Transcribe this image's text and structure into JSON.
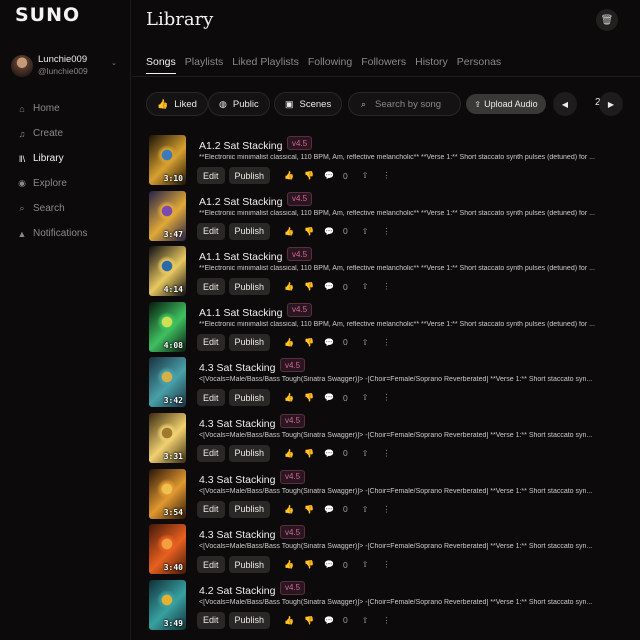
{
  "app": {
    "logo": "SUNO"
  },
  "profile": {
    "name": "Lunchie009",
    "handle": "@lunchie009"
  },
  "nav": [
    {
      "label": "Home",
      "icon": "home-icon",
      "glyph": "⌂",
      "active": false
    },
    {
      "label": "Create",
      "icon": "music-note-icon",
      "glyph": "♫",
      "active": false
    },
    {
      "label": "Library",
      "icon": "library-icon",
      "glyph": "‖\\",
      "active": true
    },
    {
      "label": "Explore",
      "icon": "compass-icon",
      "glyph": "◉",
      "active": false
    },
    {
      "label": "Search",
      "icon": "search-icon",
      "glyph": "⌕",
      "active": false
    },
    {
      "label": "Notifications",
      "icon": "bell-icon",
      "glyph": "▲",
      "active": false
    }
  ],
  "page": {
    "title": "Library"
  },
  "tabs": [
    "Songs",
    "Playlists",
    "Liked Playlists",
    "Following",
    "Followers",
    "History",
    "Personas"
  ],
  "filters": {
    "liked": "Liked",
    "public": "Public",
    "scenes": "Scenes",
    "search_placeholder": "Search by song",
    "upload": "Upload Audio",
    "page": "2"
  },
  "row_actions": {
    "edit": "Edit",
    "publish": "Publish",
    "comments": "0"
  },
  "songs": [
    {
      "title": "A1.2 Sat Stacking",
      "version": "v4.5",
      "duration": "3:10",
      "description": "**Electronic minimalist classical, 110 BPM, Am, reflective melancholic** **Verse 1:** Short staccato synth pulses (detuned) for ...",
      "colors": [
        "#1a1208",
        "#d8a030",
        "#3a7ab8"
      ]
    },
    {
      "title": "A1.2 Sat Stacking",
      "version": "v4.5",
      "duration": "3:47",
      "description": "**Electronic minimalist classical, 110 BPM, Am, reflective melancholic** **Verse 1:** Short staccato synth pulses (detuned) for ...",
      "colors": [
        "#24204a",
        "#e0a838",
        "#7a4ab0"
      ]
    },
    {
      "title": "A1.1 Sat Stacking",
      "version": "v4.5",
      "duration": "4:14",
      "description": "**Electronic minimalist classical, 110 BPM, Am, reflective melancholic** **Verse 1:** Short staccato synth pulses (detuned) for ...",
      "colors": [
        "#0c0c14",
        "#e8c860",
        "#2a6aa8"
      ]
    },
    {
      "title": "A1.1 Sat Stacking",
      "version": "v4.5",
      "duration": "4:08",
      "description": "**Electronic minimalist classical, 110 BPM, Am, reflective melancholic** **Verse 1:** Short staccato synth pulses (detuned) for ...",
      "colors": [
        "#071a0e",
        "#40c060",
        "#d0e050"
      ]
    },
    {
      "title": "4.3 Sat Stacking",
      "version": "v4.5",
      "duration": "3:42",
      "description": "<[Vocals=Male/Bass/Bass Tough(Sinatra Swagger)]> -[Choir=Female/Soprano Reverberated] **Verse 1:** Short staccato syn...",
      "colors": [
        "#1a3040",
        "#48a0a8",
        "#d8b048"
      ]
    },
    {
      "title": "4.3 Sat Stacking",
      "version": "v4.5",
      "duration": "3:31",
      "description": "<[Vocals=Male/Bass/Bass Tough(Sinatra Swagger)]> -[Choir=Female/Soprano Reverberated] **Verse 1:** Short staccato syn...",
      "colors": [
        "#3a2a10",
        "#f0d070",
        "#a07830"
      ]
    },
    {
      "title": "4.3 Sat Stacking",
      "version": "v4.5",
      "duration": "3:54",
      "description": "<[Vocals=Male/Bass/Bass Tough(Sinatra Swagger)]> -[Choir=Female/Soprano Reverberated] **Verse 1:** Short staccato syn...",
      "colors": [
        "#2a1408",
        "#e09830",
        "#f0c050"
      ]
    },
    {
      "title": "4.3 Sat Stacking",
      "version": "v4.5",
      "duration": "3:40",
      "description": "<[Vocals=Male/Bass/Bass Tough(Sinatra Swagger)]> -[Choir=Female/Soprano Reverberated] **Verse 1:** Short staccato syn...",
      "colors": [
        "#401808",
        "#e86020",
        "#f0a040"
      ]
    },
    {
      "title": "4.2 Sat Stacking",
      "version": "v4.5",
      "duration": "3:49",
      "description": "<[Vocals=Male/Bass/Bass Tough(Sinatra Swagger)]> -[Choir=Female/Soprano Reverberated] **Verse 1:** Short staccato syn...",
      "colors": [
        "#103038",
        "#38a0a0",
        "#e8b030"
      ]
    }
  ],
  "colors": {
    "badge_text": "#d9668f",
    "background": "#0c0a0a"
  }
}
